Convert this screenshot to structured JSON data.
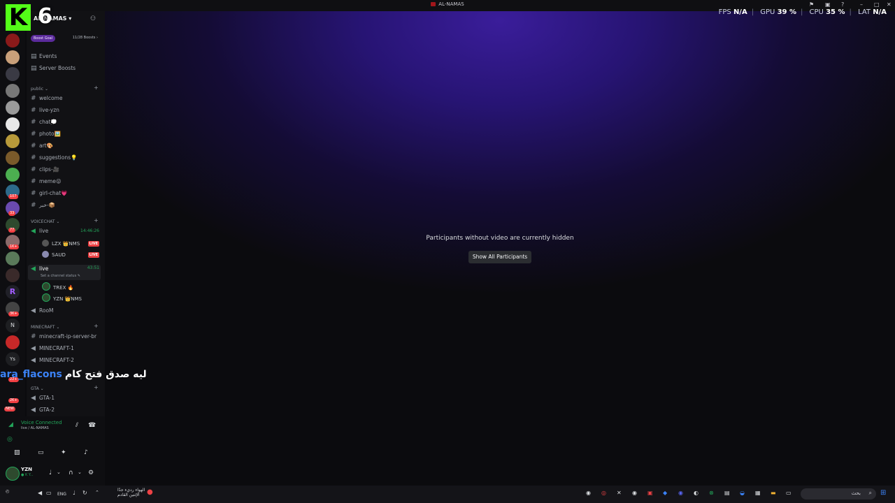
{
  "window": {
    "title": "AL-NAMAS"
  },
  "hud": {
    "fps_label": "FPS",
    "fps": "N/A",
    "gpu_label": "GPU",
    "gpu": "39 %",
    "cpu_label": "CPU",
    "cpu": "35 %",
    "lat_label": "LAT",
    "lat": "N/A"
  },
  "stream_logo": {
    "letter": "K",
    "number": "6"
  },
  "server": {
    "name": "AL-NAMAS",
    "boost_goal": "Boost Goal",
    "boost_count": "11/28 Boosts"
  },
  "menu": {
    "events": "Events",
    "boosts": "Server Boosts"
  },
  "categories": {
    "public": "public",
    "voicechat": "VOICECHAT",
    "minecraft": "MINECRAFT",
    "gta": "GTA"
  },
  "text_channels": [
    "welcome",
    "live-yzn",
    "chat💭",
    "photo🖼️",
    "art🎨",
    "suggestions💡",
    "clips-🎥",
    "meme😜",
    "girl-chat💗",
    "خبر-📦"
  ],
  "voice": {
    "live1": {
      "name": "live",
      "timer": "14:46:26",
      "users": [
        {
          "name": "LZX 👑NMS",
          "badge": "LIVE"
        },
        {
          "name": "SAUD",
          "badge": "LIVE"
        }
      ]
    },
    "live2": {
      "name": "live",
      "timer": "43:51",
      "status": "Set a channel status",
      "users": [
        {
          "name": "TREX 🔥"
        },
        {
          "name": "YZN 👑NMS"
        }
      ]
    },
    "room": "RooM"
  },
  "minecraft_channels": [
    "minecraft-ip-server-br",
    "MINECRAFT-1",
    "MINECRAFT-2"
  ],
  "gta_channels": [
    "GTA-1",
    "GTA-2"
  ],
  "guild_badges": [
    "107",
    "33",
    "77",
    "1K+",
    "3K+",
    "22+",
    "2K+",
    "NEW"
  ],
  "guild_letters": {
    "r": "R",
    "n": "N",
    "ys": "Ys"
  },
  "overlay_chat": {
    "name": "ara_flacons",
    "message": "ليه صدق فتح كام"
  },
  "stage": {
    "message": "Participants without video are currently hidden",
    "button": "Show All Participants"
  },
  "voice_panel": {
    "status": "Voice Connected",
    "channel": "live / AL-NAMAS"
  },
  "user_panel": {
    "name": "YZN",
    "sub": "● K Y..."
  },
  "taskbar": {
    "lang": "ENG",
    "notification_line1": "الهواء رديء جدًا",
    "notification_line2": "الإثنين القادم",
    "search": "بحث"
  },
  "colors": {
    "accent_green": "#23a55a",
    "live_red": "#ed4245",
    "kick_green": "#53fc18",
    "purple_glow": "#3a1d9a"
  }
}
